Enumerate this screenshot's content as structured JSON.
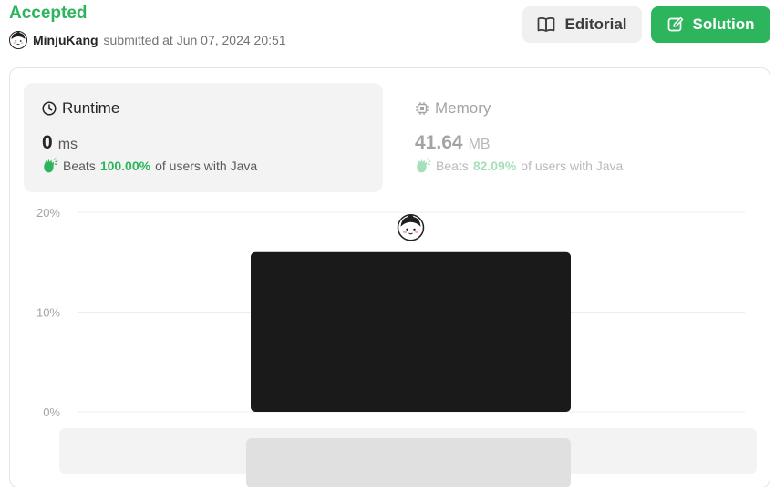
{
  "header": {
    "status": "Accepted",
    "username": "MinjuKang",
    "submitted_text": "submitted at Jun 07, 2024 20:51"
  },
  "buttons": {
    "editorial": "Editorial",
    "solution": "Solution"
  },
  "runtime": {
    "title": "Runtime",
    "value": "0",
    "unit": "ms",
    "beats_label": "Beats",
    "beats_pct": "100.00%",
    "beats_suffix": "of users with Java"
  },
  "memory": {
    "title": "Memory",
    "value": "41.64",
    "unit": "MB",
    "beats_label": "Beats",
    "beats_pct": "82.09%",
    "beats_suffix": "of users with Java"
  },
  "icons": {
    "editorial": "book-icon",
    "solution": "edit-icon",
    "runtime": "clock-icon",
    "memory": "chip-icon",
    "beats": "clap-icon",
    "avatar": "user-avatar-icon"
  },
  "colors": {
    "accent": "#2db55d",
    "bar": "#1a1a1a",
    "scrollbar_track": "#f3f3f3",
    "scrollbar_thumb": "#e0e0e0"
  },
  "chart_data": {
    "type": "bar",
    "ylim": [
      0,
      20
    ],
    "yticks": [
      "0%",
      "10%",
      "20%"
    ],
    "ytick_values": [
      0,
      10,
      20
    ],
    "values": [
      16
    ],
    "highlight_index": 0,
    "grid": true
  }
}
